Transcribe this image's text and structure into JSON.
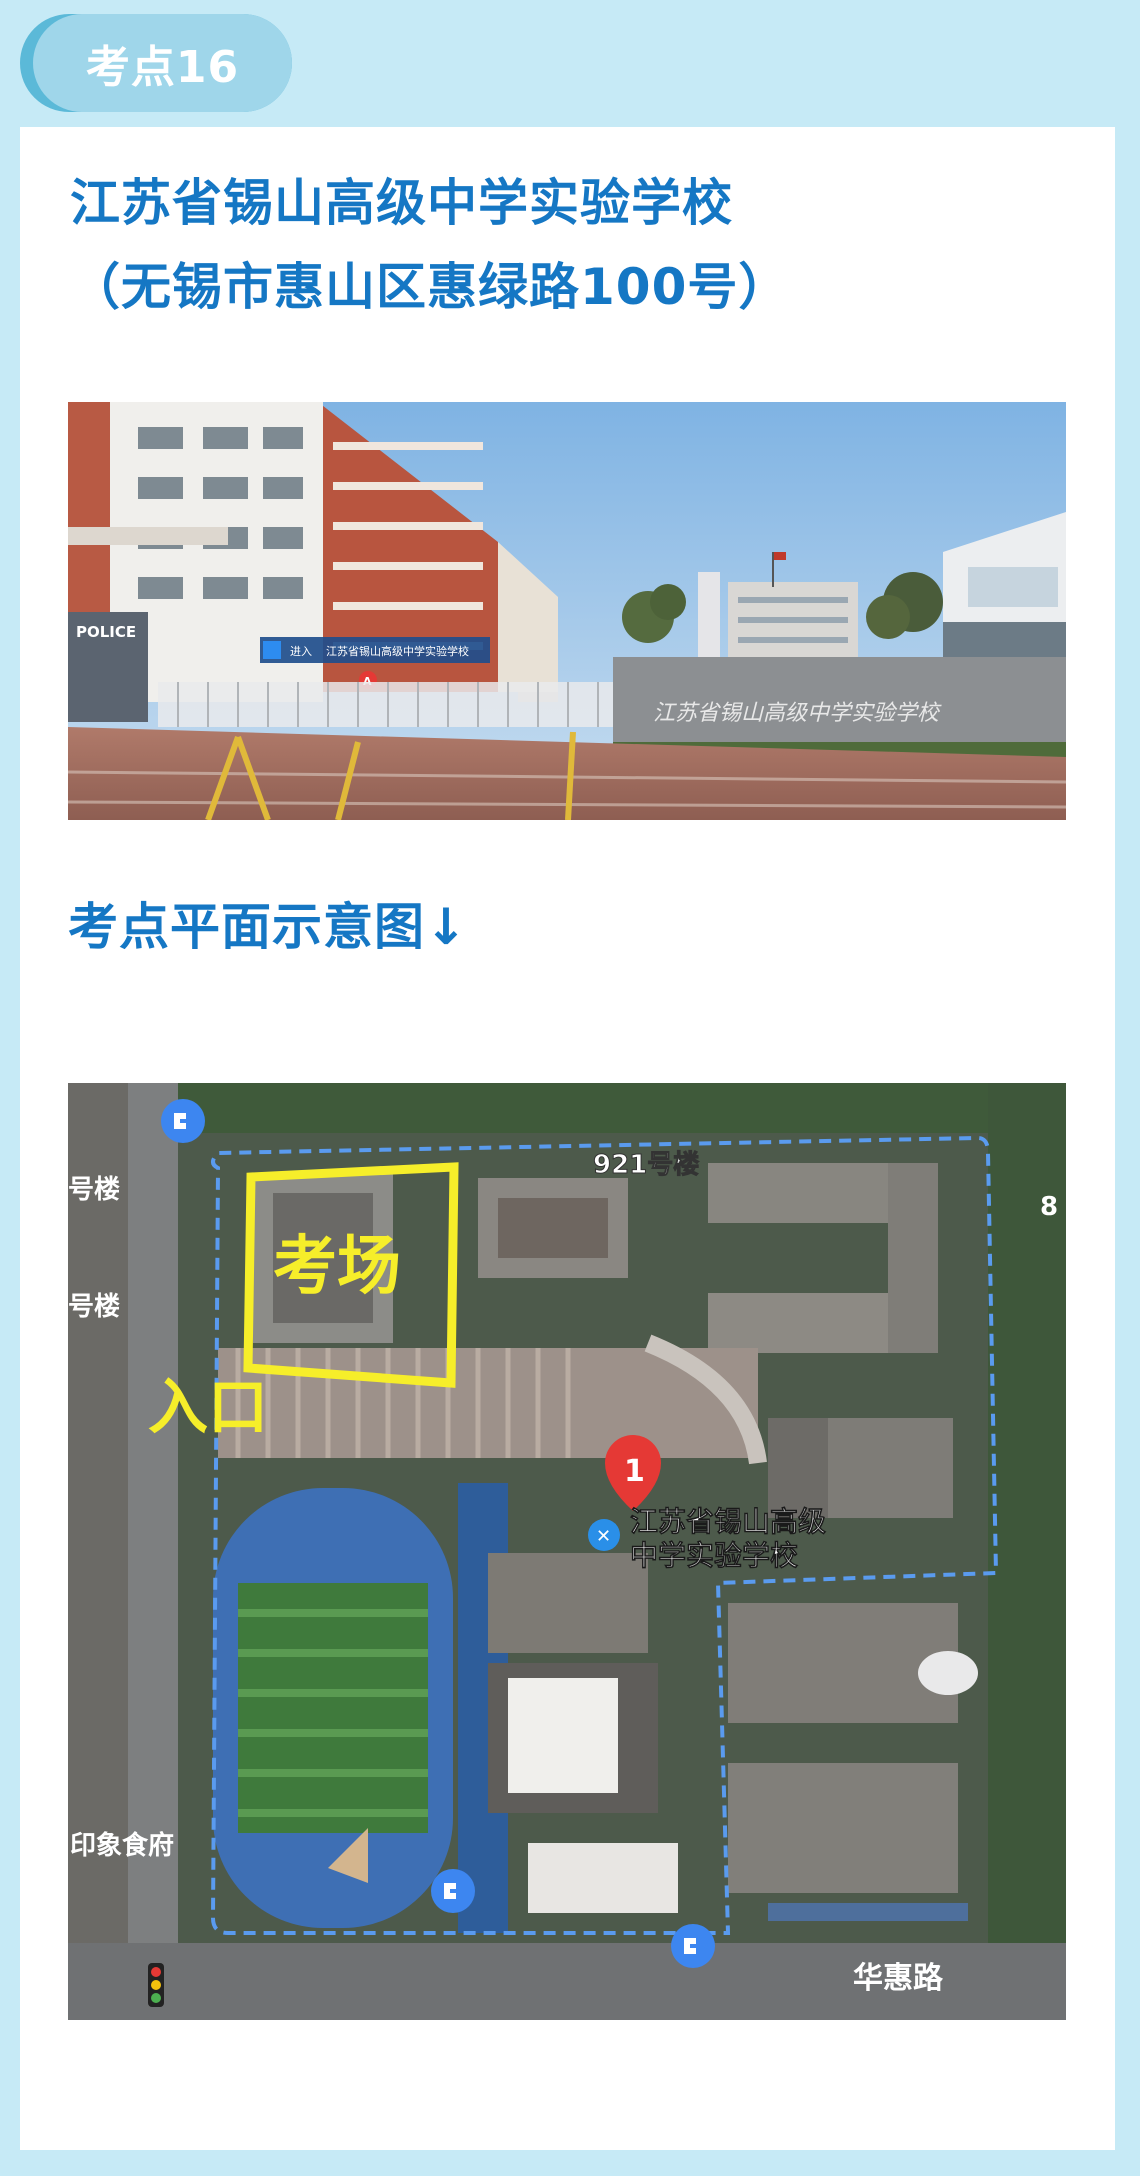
{
  "header": {
    "tag_label": "考点16"
  },
  "venue": {
    "name": "江苏省锡山高级中学实验学校",
    "address": "（无锡市惠山区惠绿路100号）"
  },
  "photo": {
    "sign_text": "江苏省锡山高级中学实验学校",
    "sign_prefix": "进入",
    "pin_letter": "A",
    "police_text": "POLICE",
    "wall_text": "江苏省锡山高级中学实验学校"
  },
  "plan": {
    "section_title": "考点平面示意图↓",
    "exam_label": "考场",
    "entrance_label": "入口",
    "building_label": "921号楼",
    "pin_number": "1",
    "pin_label_line1": "江苏省锡山高级",
    "pin_label_line2": "中学实验学校",
    "left_label_1": "号楼",
    "left_label_2": "号楼",
    "restaurant_label": "印象食府",
    "road_label": "华惠路",
    "right_edge_label": "8"
  }
}
